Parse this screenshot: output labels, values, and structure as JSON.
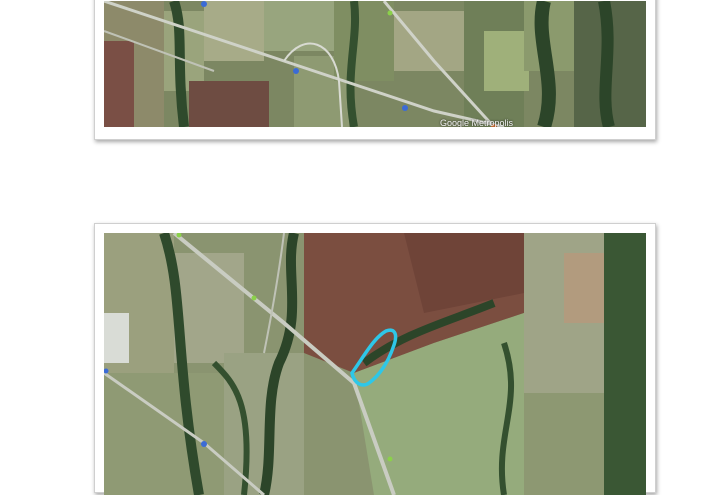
{
  "figures": [
    {
      "id_label": "top-map",
      "watermark": "Google  Metropolis",
      "colors": {
        "field_green": "#8a9a6a",
        "field_brown": "#7a5a48",
        "forest": "#2f4a2c",
        "road": "#cfd2c8"
      }
    },
    {
      "id_label": "bottom-map",
      "watermark": "",
      "colors": {
        "field_green": "#95a37a",
        "field_brown": "#7b4e40",
        "forest": "#2c4529",
        "road": "#c9ccc2",
        "highlight": "#2ec7e8"
      }
    }
  ]
}
